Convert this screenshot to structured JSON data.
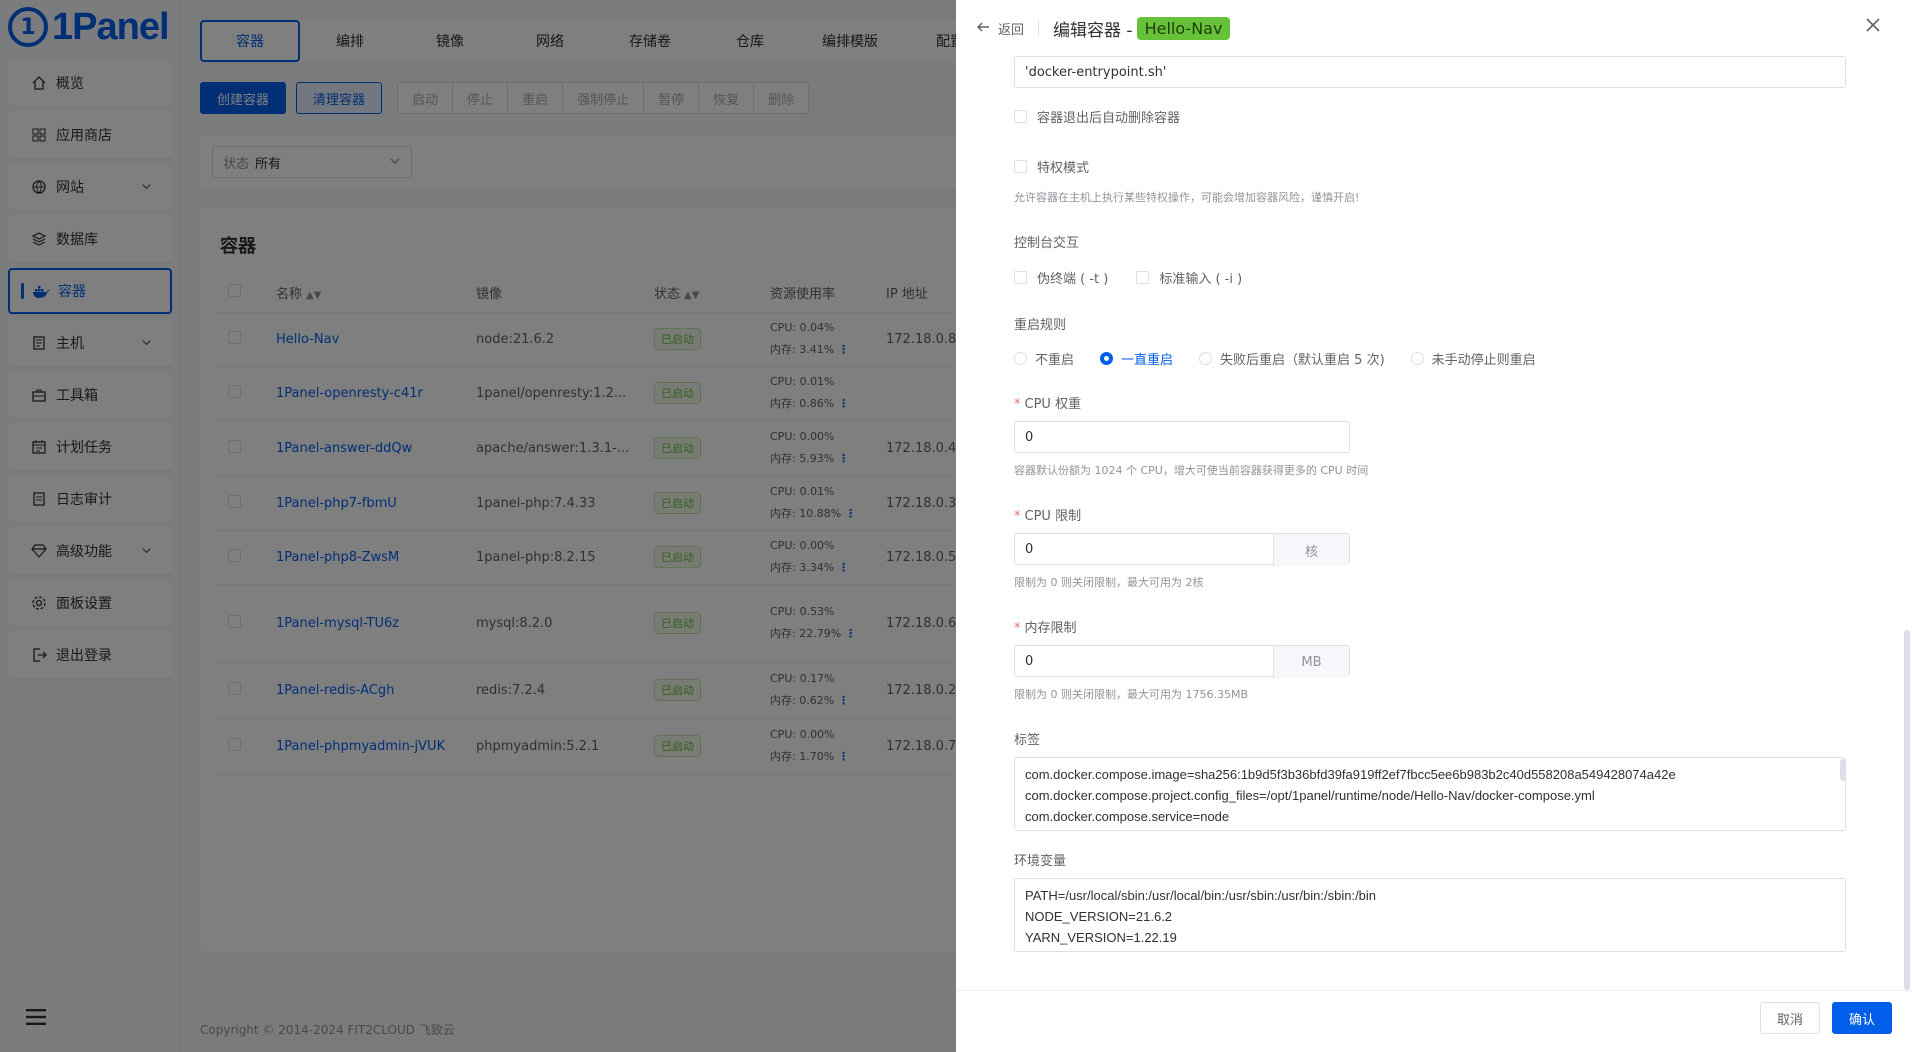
{
  "brand": {
    "logo_text": "1Panel"
  },
  "sidebar": {
    "items": [
      {
        "label": "概览",
        "icon": "home-icon",
        "has_chevron": false,
        "active": false
      },
      {
        "label": "应用商店",
        "icon": "grid-icon",
        "has_chevron": false,
        "active": false
      },
      {
        "label": "网站",
        "icon": "globe-icon",
        "has_chevron": true,
        "active": false
      },
      {
        "label": "数据库",
        "icon": "layers-icon",
        "has_chevron": false,
        "active": false
      },
      {
        "label": "容器",
        "icon": "docker-icon",
        "has_chevron": false,
        "active": true
      },
      {
        "label": "主机",
        "icon": "server-icon",
        "has_chevron": true,
        "active": false
      },
      {
        "label": "工具箱",
        "icon": "toolbox-icon",
        "has_chevron": false,
        "active": false
      },
      {
        "label": "计划任务",
        "icon": "calendar-icon",
        "has_chevron": false,
        "active": false
      },
      {
        "label": "日志审计",
        "icon": "log-icon",
        "has_chevron": false,
        "active": false
      },
      {
        "label": "高级功能",
        "icon": "diamond-icon",
        "has_chevron": true,
        "active": false
      },
      {
        "label": "面板设置",
        "icon": "gear-icon",
        "has_chevron": false,
        "active": false
      },
      {
        "label": "退出登录",
        "icon": "logout-icon",
        "has_chevron": false,
        "active": false
      }
    ]
  },
  "tabs": [
    "容器",
    "编排",
    "镜像",
    "网络",
    "存储卷",
    "仓库",
    "编排模版",
    "配置"
  ],
  "toolbar": {
    "create": "创建容器",
    "clean": "清理容器",
    "actions": [
      "启动",
      "停止",
      "重启",
      "强制停止",
      "暂停",
      "恢复",
      "删除"
    ]
  },
  "filter": {
    "label": "状态",
    "value": "所有"
  },
  "table": {
    "title": "容器",
    "headers": {
      "name": "名称",
      "image": "镜像",
      "status": "状态",
      "resource": "资源使用率",
      "ip": "IP 地址"
    },
    "rows": [
      {
        "name": "Hello-Nav",
        "image": "node:21.6.2",
        "status": "已启动",
        "cpu": "CPU: 0.04%",
        "mem": "内存: 3.41%",
        "ip": "172.18.0.8"
      },
      {
        "name": "1Panel-openresty-c41r",
        "image": "1panel/openresty:1.2...",
        "status": "已启动",
        "cpu": "CPU: 0.01%",
        "mem": "内存: 0.86%",
        "ip": ""
      },
      {
        "name": "1Panel-answer-ddQw",
        "image": "apache/answer:1.3.1-...",
        "status": "已启动",
        "cpu": "CPU: 0.00%",
        "mem": "内存: 5.93%",
        "ip": "172.18.0.4"
      },
      {
        "name": "1Panel-php7-fbmU",
        "image": "1panel-php:7.4.33",
        "status": "已启动",
        "cpu": "CPU: 0.01%",
        "mem": "内存: 10.88%",
        "ip": "172.18.0.3"
      },
      {
        "name": "1Panel-php8-ZwsM",
        "image": "1panel-php:8.2.15",
        "status": "已启动",
        "cpu": "CPU: 0.00%",
        "mem": "内存: 3.34%",
        "ip": "172.18.0.5"
      },
      {
        "name": "1Panel-mysql-TU6z",
        "image": "mysql:8.2.0",
        "status": "已启动",
        "cpu": "CPU: 0.53%",
        "mem": "内存: 22.79%",
        "ip": "172.18.0.6"
      },
      {
        "name": "1Panel-redis-ACgh",
        "image": "redis:7.2.4",
        "status": "已启动",
        "cpu": "CPU: 0.17%",
        "mem": "内存: 0.62%",
        "ip": "172.18.0.2"
      },
      {
        "name": "1Panel-phpmyadmin-jVUK",
        "image": "phpmyadmin:5.2.1",
        "status": "已启动",
        "cpu": "CPU: 0.00%",
        "mem": "内存: 1.70%",
        "ip": "172.18.0.7"
      }
    ]
  },
  "footer": {
    "copyright": "Copyright © 2014-2024 FIT2CLOUD 飞致云"
  },
  "drawer": {
    "back": "返回",
    "title": "编辑容器 -",
    "container_name": "Hello-Nav",
    "entrypoint_value": "'docker-entrypoint.sh'",
    "auto_remove": "容器退出后自动删除容器",
    "privileged": "特权模式",
    "privileged_hint": "允许容器在主机上执行某些特权操作，可能会增加容器风险，谨慎开启!",
    "console_label": "控制台交互",
    "tty": "伪终端 ( -t )",
    "stdin": "标准输入 ( -i )",
    "restart_label": "重启规则",
    "restart_options": [
      {
        "label": "不重启",
        "checked": false
      },
      {
        "label": "一直重启",
        "checked": true
      },
      {
        "label": "失败后重启（默认重启 5 次)",
        "checked": false
      },
      {
        "label": "未手动停止则重启",
        "checked": false
      }
    ],
    "cpu_weight_label": "CPU 权重",
    "cpu_weight_value": "0",
    "cpu_weight_hint": "容器默认份额为 1024 个 CPU，增大可使当前容器获得更多的 CPU 时间",
    "cpu_limit_label": "CPU 限制",
    "cpu_limit_value": "0",
    "cpu_limit_unit": "核",
    "cpu_limit_hint": "限制为 0 则关闭限制，最大可用为 2核",
    "mem_limit_label": "内存限制",
    "mem_limit_value": "0",
    "mem_limit_unit": "MB",
    "mem_limit_hint": "限制为 0 则关闭限制，最大可用为 1756.35MB",
    "labels_label": "标签",
    "labels_value": "com.docker.compose.image=sha256:1b9d5f3b36bfd39fa919ff2ef7fbcc5ee6b983b2c40d558208a549428074a42e\ncom.docker.compose.project.config_files=/opt/1panel/runtime/node/Hello-Nav/docker-compose.yml\ncom.docker.compose.service=node",
    "env_label": "环境变量",
    "env_value": "PATH=/usr/local/sbin:/usr/local/bin:/usr/sbin:/usr/bin:/sbin:/bin\nNODE_VERSION=21.6.2\nYARN_VERSION=1.22.19",
    "cancel": "取消",
    "confirm": "确认"
  },
  "colors": {
    "primary": "#005eeb",
    "success": "#67c23a",
    "danger": "#f56c6c"
  }
}
